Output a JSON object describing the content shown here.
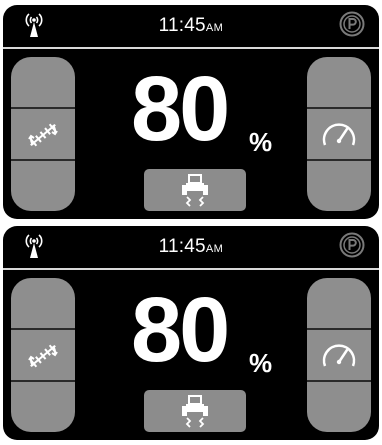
{
  "screens": [
    {
      "clock": {
        "time": "11:45",
        "ampm": "AM"
      },
      "value": {
        "number": "80",
        "unit": "%"
      },
      "icons": {
        "status_left": "wireless-signal-icon",
        "status_right": "parking-brake-icon",
        "left_panel": "rotate-implement-icon",
        "right_panel": "speedometer-icon",
        "mode_button": "tractor-suspension-icon"
      }
    },
    {
      "clock": {
        "time": "11:45",
        "ampm": "AM"
      },
      "value": {
        "number": "80",
        "unit": "%"
      },
      "icons": {
        "status_left": "wireless-signal-icon",
        "status_right": "parking-brake-icon",
        "left_panel": "rotate-implement-icon",
        "right_panel": "speedometer-icon",
        "mode_button": "tractor-suspension-icon"
      }
    }
  ],
  "colors": {
    "screen_bg": "#000000",
    "panel_gray": "#8e8e8e",
    "text": "#ffffff",
    "divider": "#d8d8d8"
  }
}
